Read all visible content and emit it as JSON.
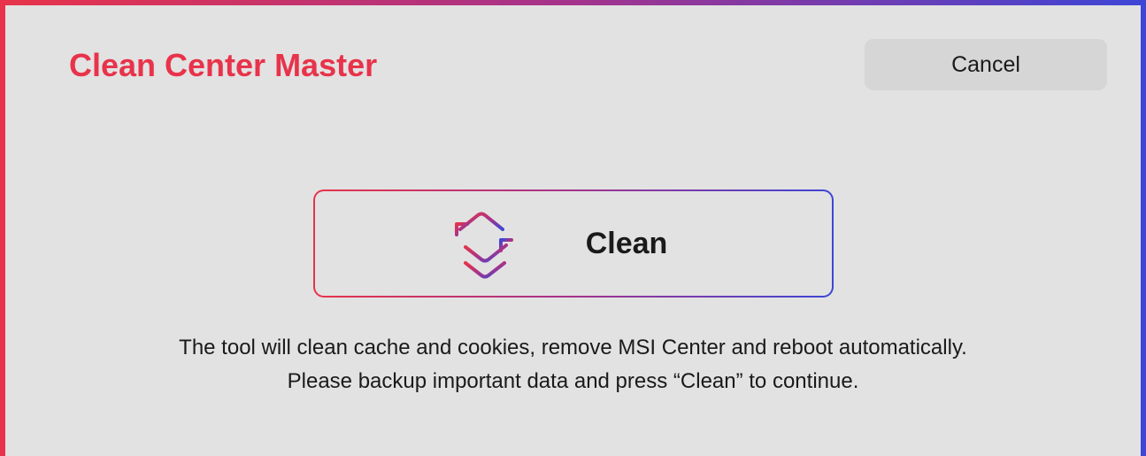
{
  "app": {
    "title": "Clean Center Master"
  },
  "header": {
    "cancel_label": "Cancel"
  },
  "clean": {
    "label": "Clean",
    "icon": "sync-arrows-icon"
  },
  "description": {
    "line1": "The tool will clean cache and cookies, remove MSI Center and reboot automatically.",
    "line2": "Please backup important data and press “Clean” to continue."
  },
  "colors": {
    "accent_red": "#e8334a",
    "accent_purple": "#a4338c",
    "accent_blue": "#3d46d6",
    "background": "#e2e2e2",
    "button_bg": "#d6d6d6",
    "text": "#1a1a1a"
  }
}
